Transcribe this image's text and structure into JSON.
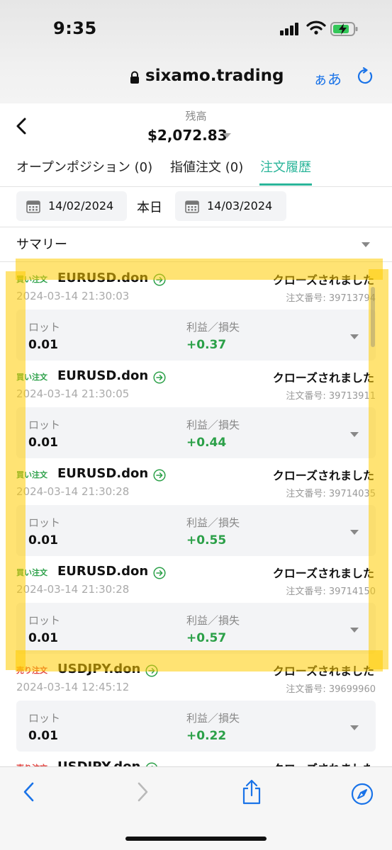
{
  "status_bar": {
    "time": "9:35"
  },
  "browser": {
    "url": "sixamo.trading",
    "text_size_label": "ぁあ"
  },
  "header": {
    "balance_label": "残高",
    "balance_value": "$2,072.83"
  },
  "tabs": [
    {
      "label": "オープンポジション (0)",
      "active": false
    },
    {
      "label": "指値注文 (0)",
      "active": false
    },
    {
      "label": "注文履歴",
      "active": true
    }
  ],
  "filters": {
    "date_from": "14/02/2024",
    "today_label": "本日",
    "date_to": "14/03/2024"
  },
  "summary": {
    "label": "サマリー"
  },
  "orders": [
    {
      "type": "買い注文",
      "side": "buy",
      "symbol": "EURUSD.don",
      "status": "クローズされました",
      "datetime": "2024-03-14 21:30:03",
      "order_no": "注文番号: 39713794",
      "lot_label": "ロット",
      "lot": "0.01",
      "pl_label": "利益／損失",
      "pl": "+0.37"
    },
    {
      "type": "買い注文",
      "side": "buy",
      "symbol": "EURUSD.don",
      "status": "クローズされました",
      "datetime": "2024-03-14 21:30:05",
      "order_no": "注文番号: 39713911",
      "lot_label": "ロット",
      "lot": "0.01",
      "pl_label": "利益／損失",
      "pl": "+0.44"
    },
    {
      "type": "買い注文",
      "side": "buy",
      "symbol": "EURUSD.don",
      "status": "クローズされました",
      "datetime": "2024-03-14 21:30:28",
      "order_no": "注文番号: 39714035",
      "lot_label": "ロット",
      "lot": "0.01",
      "pl_label": "利益／損失",
      "pl": "+0.55"
    },
    {
      "type": "買い注文",
      "side": "buy",
      "symbol": "EURUSD.don",
      "status": "クローズされました",
      "datetime": "2024-03-14 21:30:28",
      "order_no": "注文番号: 39714150",
      "lot_label": "ロット",
      "lot": "0.01",
      "pl_label": "利益／損失",
      "pl": "+0.57"
    },
    {
      "type": "売り注文",
      "side": "sell",
      "symbol": "USDJPY.don",
      "status": "クローズされました",
      "datetime": "2024-03-14 12:45:12",
      "order_no": "注文番号: 39699960",
      "lot_label": "ロット",
      "lot": "0.01",
      "pl_label": "利益／損失",
      "pl": "+0.22"
    },
    {
      "type": "売り注文",
      "side": "sell",
      "symbol": "USDJPY.don",
      "status": "クローズされました",
      "datetime": "",
      "order_no": "",
      "lot_label": "",
      "lot": "",
      "pl_label": "",
      "pl": ""
    }
  ],
  "colors": {
    "accent": "#2bb59a",
    "buy": "#2ba048",
    "sell": "#e0413d",
    "highlight": "#ffcc00",
    "link": "#1a73e8"
  },
  "icons": {
    "back": "chevron-left-icon",
    "calendar": "calendar-icon",
    "detail": "arrow-right-circle-icon",
    "share": "share-icon",
    "compass": "compass-icon",
    "lock": "lock-icon",
    "reload": "reload-icon"
  }
}
